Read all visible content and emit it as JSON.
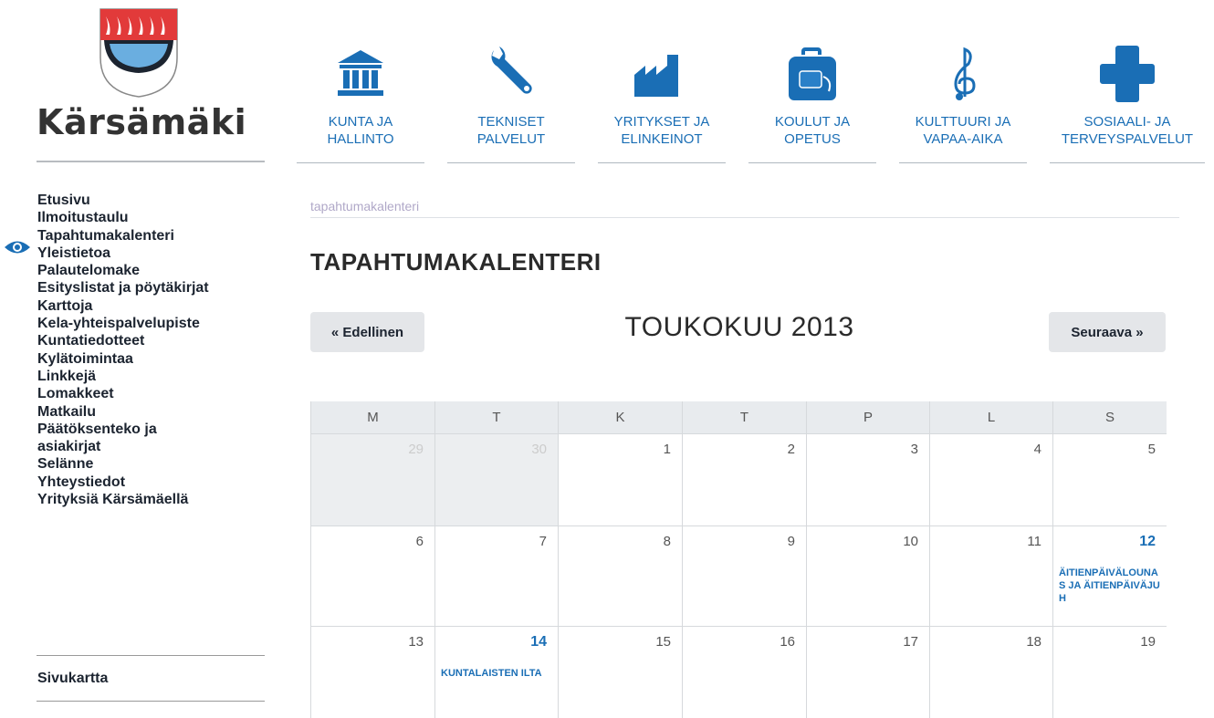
{
  "brand": {
    "name": "Kärsämäki"
  },
  "nav": [
    {
      "label_1": "KUNTA JA",
      "label_2": "HALLINTO",
      "icon": "institution-icon"
    },
    {
      "label_1": "TEKNISET",
      "label_2": "PALVELUT",
      "icon": "wrench-icon"
    },
    {
      "label_1": "YRITYKSET JA",
      "label_2": "ELINKEINOT",
      "icon": "factory-icon"
    },
    {
      "label_1": "KOULUT JA",
      "label_2": "OPETUS",
      "icon": "backpack-icon"
    },
    {
      "label_1": "KULTTUURI JA",
      "label_2": "VAPAA-AIKA",
      "icon": "treble-clef-icon"
    },
    {
      "label_1": "SOSIAALI- JA",
      "label_2": "TERVEYSPALVELUT",
      "icon": "cross-icon"
    }
  ],
  "sidebar": {
    "items": [
      "Etusivu",
      "Ilmoitustaulu",
      "Tapahtumakalenteri",
      "Yleistietoa",
      "Palautelomake",
      "Esityslistat ja pöytäkirjat",
      "Karttoja",
      "Kela-yhteispalvelupiste",
      "Kuntatiedotteet",
      "Kylätoimintaa",
      "Linkkejä",
      "Lomakkeet",
      "Matkailu",
      "Päätöksenteko ja",
      "asiakirjat",
      "Selänne",
      "Yhteystiedot",
      "Yrityksiä Kärsämäellä"
    ],
    "active": "Tapahtumakalenteri",
    "sitemap": "Sivukartta"
  },
  "breadcrumb": "tapahtumakalenteri",
  "page_title": "TAPAHTUMAKALENTERI",
  "calendar": {
    "prev_label": "« Edellinen",
    "next_label": "Seuraava »",
    "month_title": "TOUKOKUU 2013",
    "weekdays": [
      "M",
      "T",
      "K",
      "T",
      "P",
      "L",
      "S"
    ],
    "weeks": [
      [
        {
          "day": "29",
          "muted": true
        },
        {
          "day": "30",
          "muted": true
        },
        {
          "day": "1"
        },
        {
          "day": "2"
        },
        {
          "day": "3"
        },
        {
          "day": "4"
        },
        {
          "day": "5"
        }
      ],
      [
        {
          "day": "6"
        },
        {
          "day": "7"
        },
        {
          "day": "8"
        },
        {
          "day": "9"
        },
        {
          "day": "10"
        },
        {
          "day": "11"
        },
        {
          "day": "12",
          "event": "ÄITIENPÄIVÄLOUNAS ja ÄITIENPÄIVÄJUH"
        }
      ],
      [
        {
          "day": "13"
        },
        {
          "day": "14",
          "event": "KUNTALAISTEN ILTA"
        },
        {
          "day": "15"
        },
        {
          "day": "16"
        },
        {
          "day": "17"
        },
        {
          "day": "18"
        },
        {
          "day": "19"
        }
      ]
    ]
  },
  "colors": {
    "accent": "#1a6eb5",
    "shield_red": "#e23a3a",
    "shield_blue": "#6aaee0"
  }
}
